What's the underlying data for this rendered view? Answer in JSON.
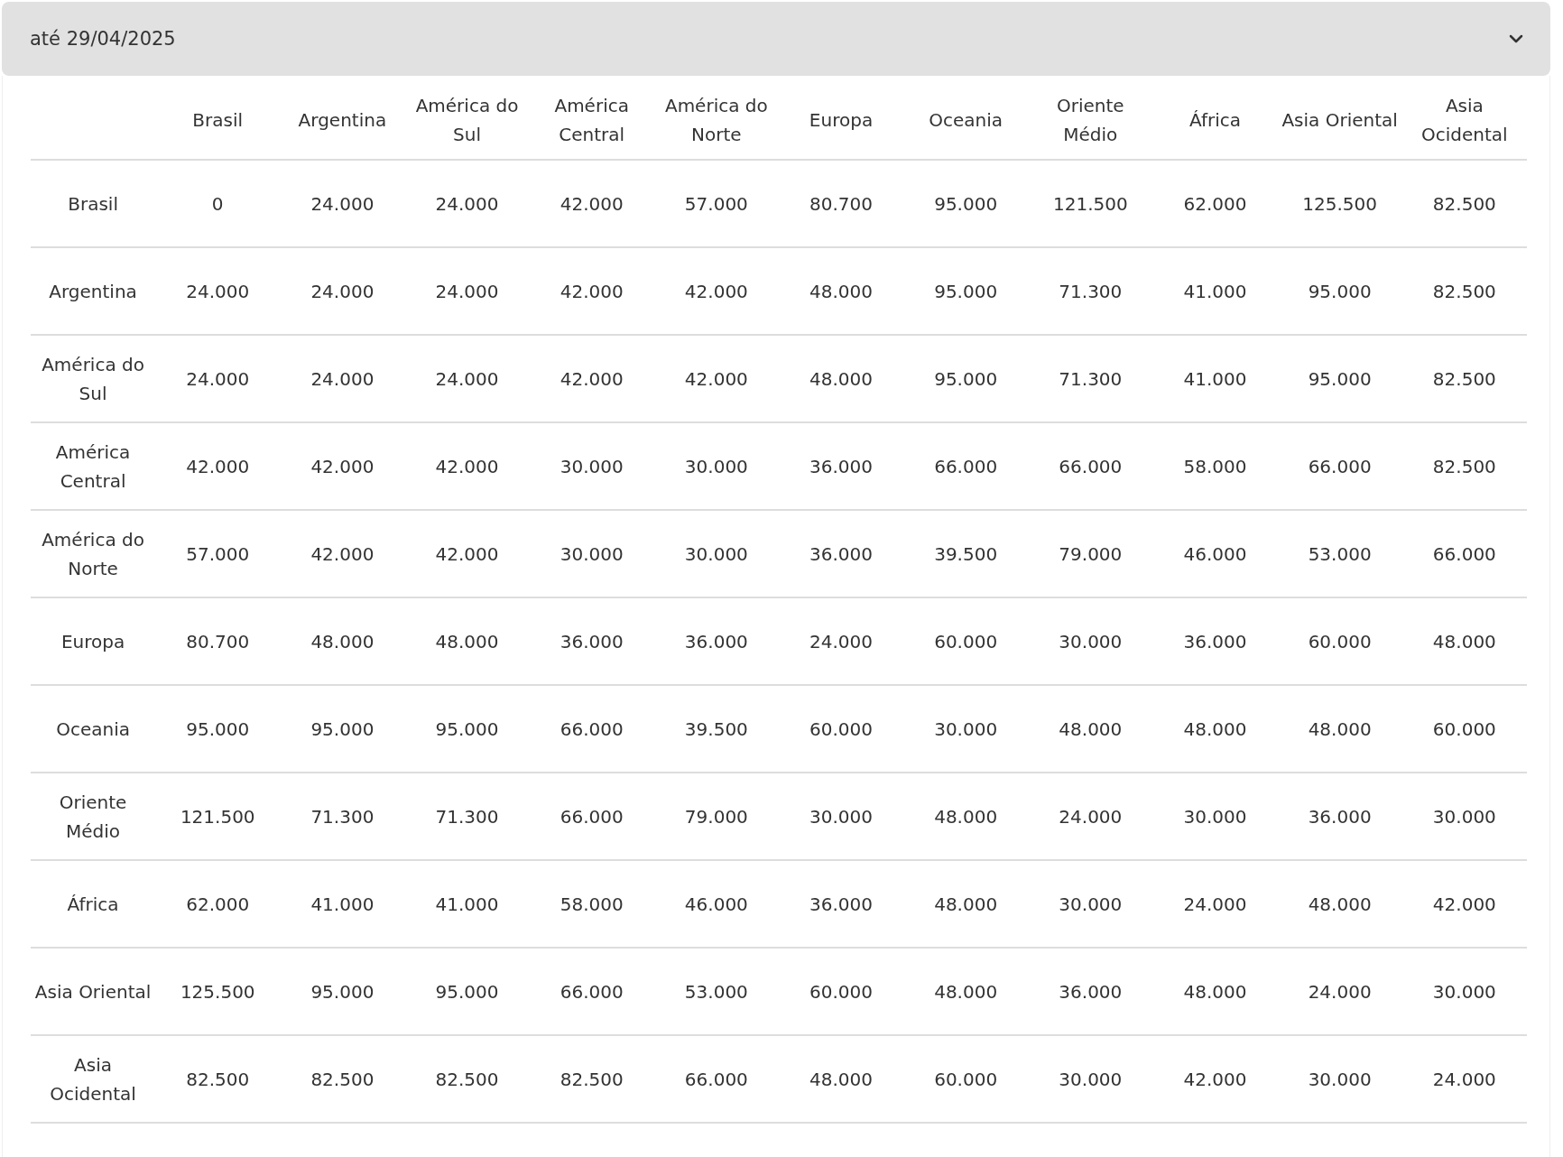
{
  "accordion": {
    "title": "até 29/04/2025",
    "expanded": true
  },
  "table": {
    "columns": [
      "Brasil",
      "Argentina",
      "América do Sul",
      "América Central",
      "América do Norte",
      "Europa",
      "Oceania",
      "Oriente Médio",
      "África",
      "Asia Oriental",
      "Asia Ocidental"
    ],
    "rows": [
      {
        "label": "Brasil",
        "cells": [
          "0",
          "24.000",
          "24.000",
          "42.000",
          "57.000",
          "80.700",
          "95.000",
          "121.500",
          "62.000",
          "125.500",
          "82.500"
        ]
      },
      {
        "label": "Argentina",
        "cells": [
          "24.000",
          "24.000",
          "24.000",
          "42.000",
          "42.000",
          "48.000",
          "95.000",
          "71.300",
          "41.000",
          "95.000",
          "82.500"
        ]
      },
      {
        "label": "América do Sul",
        "cells": [
          "24.000",
          "24.000",
          "24.000",
          "42.000",
          "42.000",
          "48.000",
          "95.000",
          "71.300",
          "41.000",
          "95.000",
          "82.500"
        ]
      },
      {
        "label": "América Central",
        "cells": [
          "42.000",
          "42.000",
          "42.000",
          "30.000",
          "30.000",
          "36.000",
          "66.000",
          "66.000",
          "58.000",
          "66.000",
          "82.500"
        ]
      },
      {
        "label": "América do Norte",
        "cells": [
          "57.000",
          "42.000",
          "42.000",
          "30.000",
          "30.000",
          "36.000",
          "39.500",
          "79.000",
          "46.000",
          "53.000",
          "66.000"
        ]
      },
      {
        "label": "Europa",
        "cells": [
          "80.700",
          "48.000",
          "48.000",
          "36.000",
          "36.000",
          "24.000",
          "60.000",
          "30.000",
          "36.000",
          "60.000",
          "48.000"
        ]
      },
      {
        "label": "Oceania",
        "cells": [
          "95.000",
          "95.000",
          "95.000",
          "66.000",
          "39.500",
          "60.000",
          "30.000",
          "48.000",
          "48.000",
          "48.000",
          "60.000"
        ]
      },
      {
        "label": "Oriente Médio",
        "cells": [
          "121.500",
          "71.300",
          "71.300",
          "66.000",
          "79.000",
          "30.000",
          "48.000",
          "24.000",
          "30.000",
          "36.000",
          "30.000"
        ]
      },
      {
        "label": "África",
        "cells": [
          "62.000",
          "41.000",
          "41.000",
          "58.000",
          "46.000",
          "36.000",
          "48.000",
          "30.000",
          "24.000",
          "48.000",
          "42.000"
        ]
      },
      {
        "label": "Asia Oriental",
        "cells": [
          "125.500",
          "95.000",
          "95.000",
          "66.000",
          "53.000",
          "60.000",
          "48.000",
          "36.000",
          "48.000",
          "24.000",
          "30.000"
        ]
      },
      {
        "label": "Asia Ocidental",
        "cells": [
          "82.500",
          "82.500",
          "82.500",
          "82.500",
          "66.000",
          "48.000",
          "60.000",
          "30.000",
          "42.000",
          "30.000",
          "24.000"
        ]
      }
    ]
  }
}
